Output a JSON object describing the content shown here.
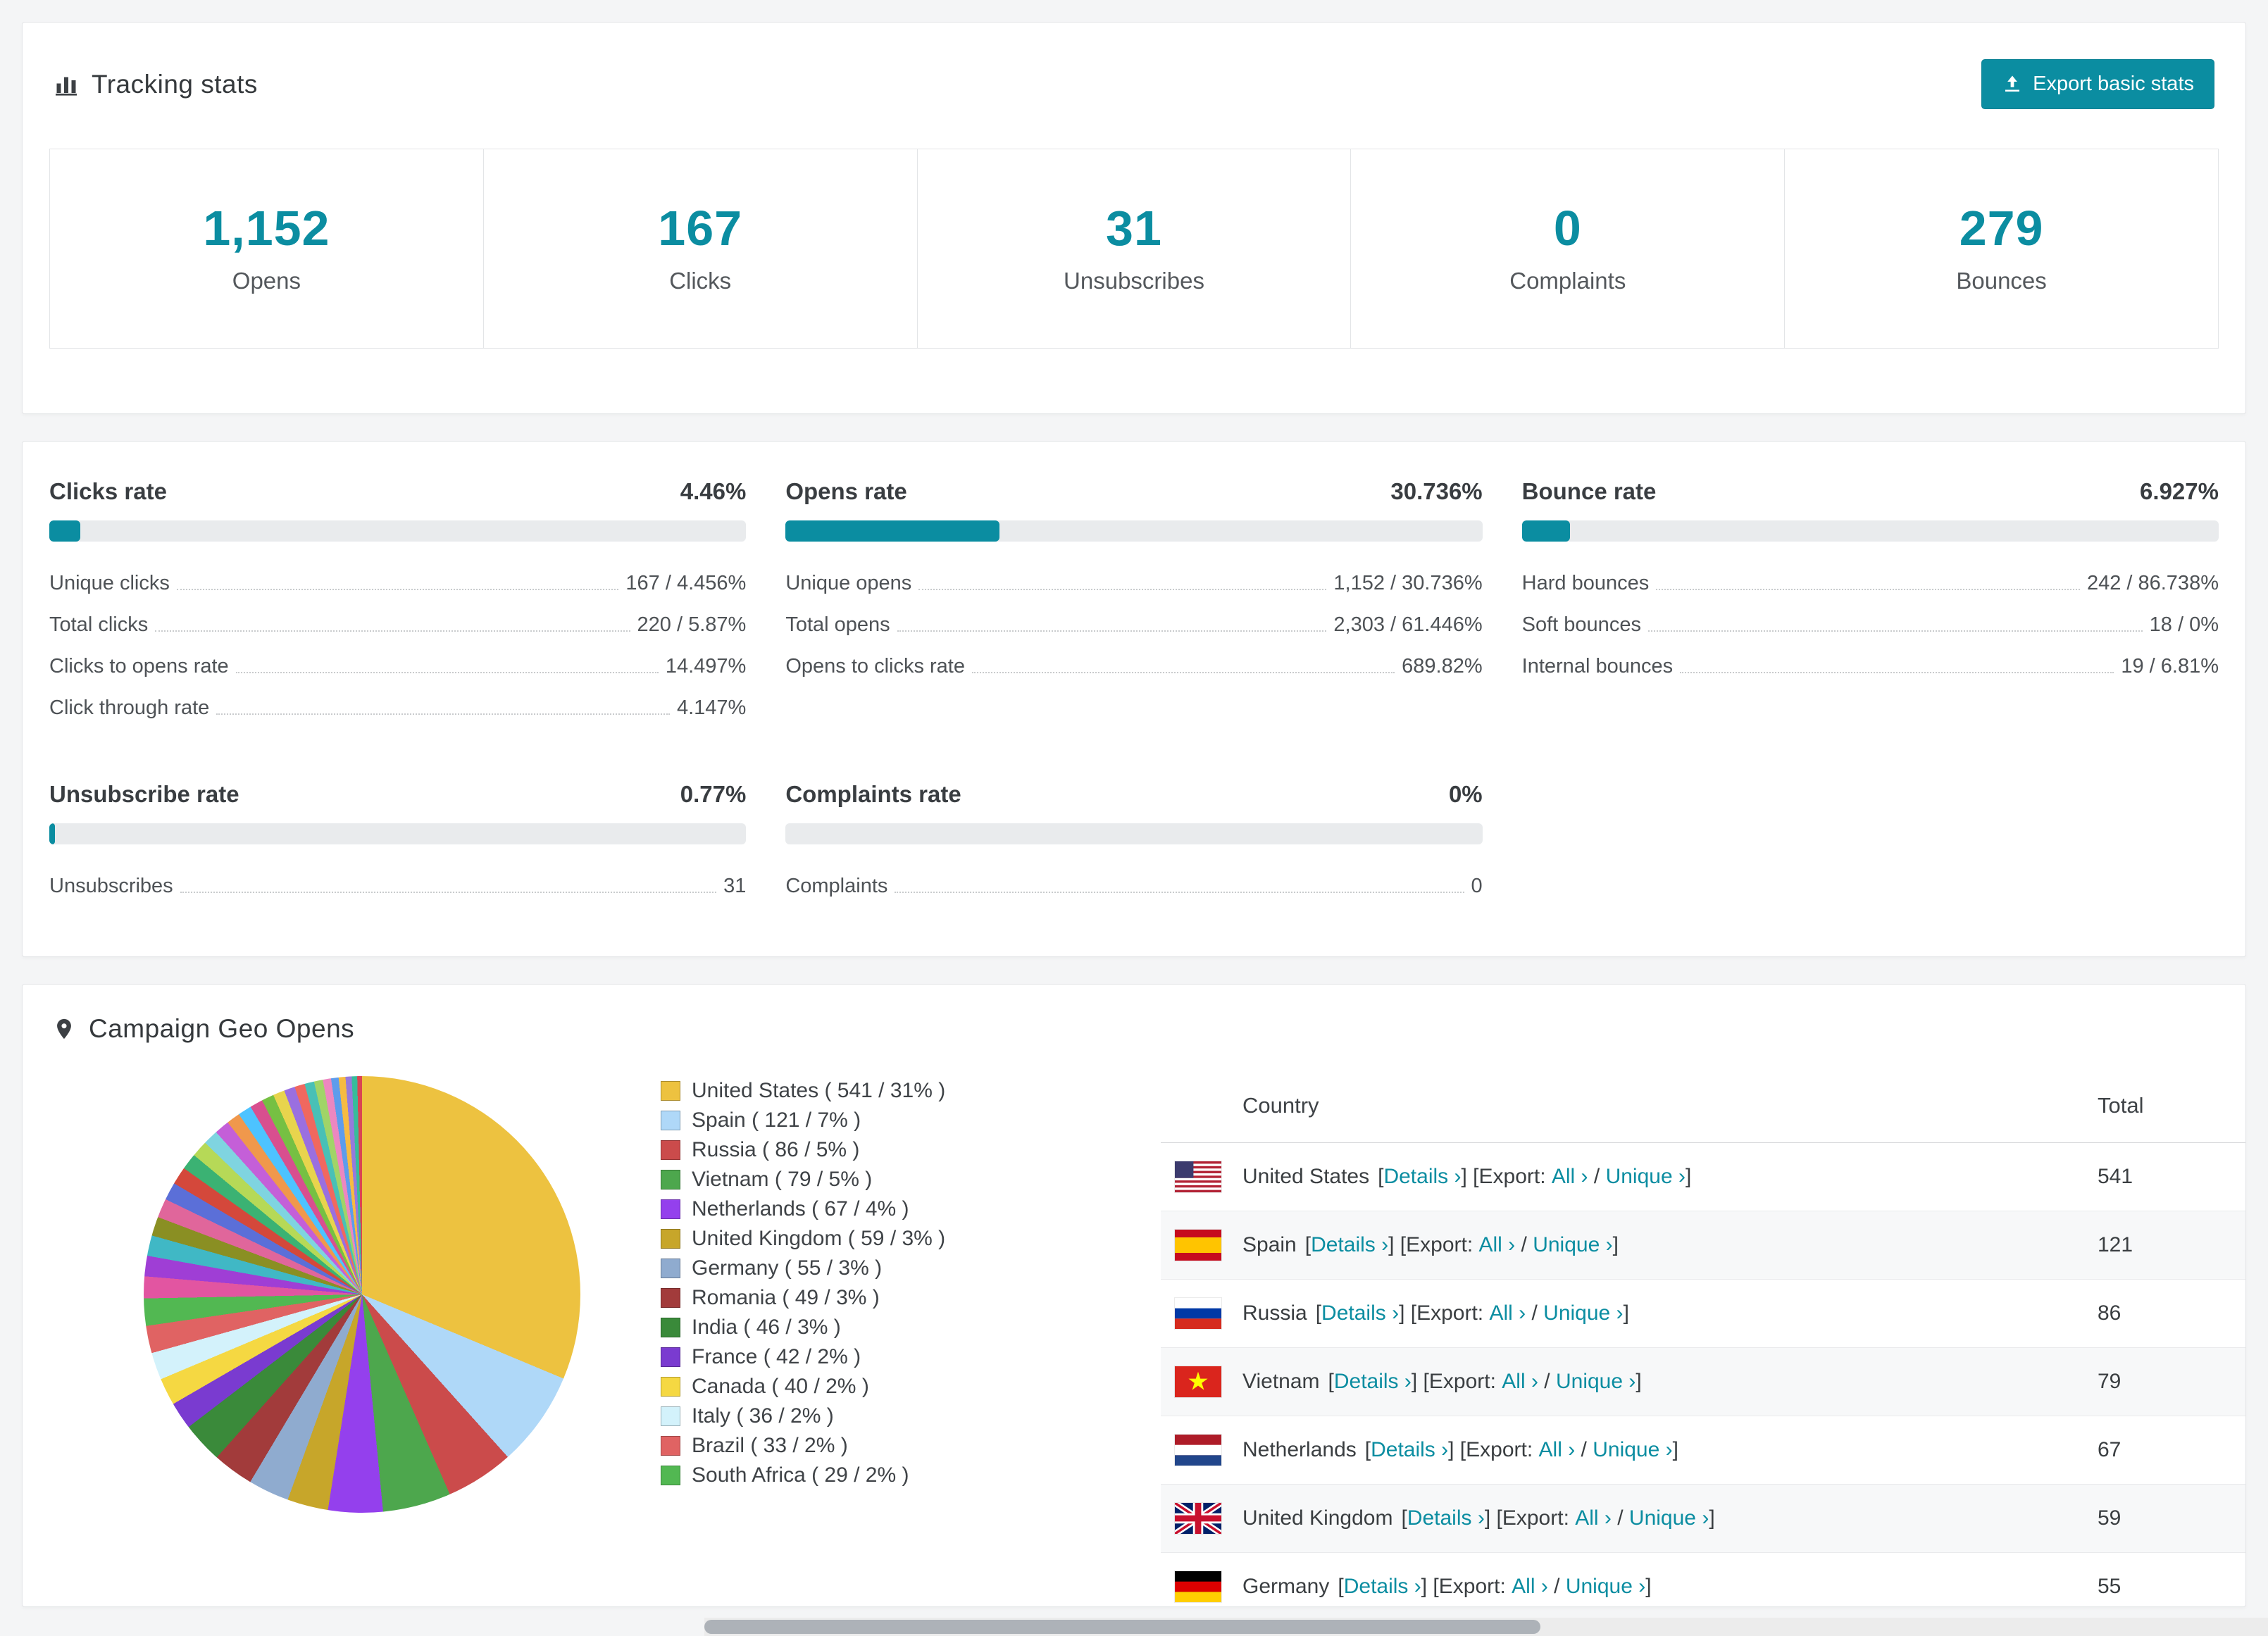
{
  "colors": {
    "accent": "#0b8da1",
    "page_bg": "#f4f5f6",
    "bar_track": "#e9ebed"
  },
  "tracking": {
    "title": "Tracking stats",
    "export_button": "Export basic stats",
    "icons": {
      "header": "bar-chart-icon",
      "export": "export-icon"
    },
    "stats": [
      {
        "value": "1,152",
        "label": "Opens"
      },
      {
        "value": "167",
        "label": "Clicks"
      },
      {
        "value": "31",
        "label": "Unsubscribes"
      },
      {
        "value": "0",
        "label": "Complaints"
      },
      {
        "value": "279",
        "label": "Bounces"
      }
    ]
  },
  "rates": [
    {
      "title": "Clicks rate",
      "value": "4.46%",
      "percent": 4.46,
      "rows": [
        {
          "label": "Unique clicks",
          "value": "167 / 4.456%"
        },
        {
          "label": "Total clicks",
          "value": "220 / 5.87%"
        },
        {
          "label": "Clicks to opens rate",
          "value": "14.497%"
        },
        {
          "label": "Click through rate",
          "value": "4.147%"
        }
      ]
    },
    {
      "title": "Opens rate",
      "value": "30.736%",
      "percent": 30.736,
      "rows": [
        {
          "label": "Unique opens",
          "value": "1,152 / 30.736%"
        },
        {
          "label": "Total opens",
          "value": "2,303 / 61.446%"
        },
        {
          "label": "Opens to clicks rate",
          "value": "689.82%"
        }
      ]
    },
    {
      "title": "Bounce rate",
      "value": "6.927%",
      "percent": 6.927,
      "rows": [
        {
          "label": "Hard bounces",
          "value": "242 / 86.738%"
        },
        {
          "label": "Soft bounces",
          "value": "18 / 0%"
        },
        {
          "label": "Internal bounces",
          "value": "19 / 6.81%"
        }
      ]
    },
    {
      "title": "Unsubscribe rate",
      "value": "0.77%",
      "percent": 0.77,
      "rows": [
        {
          "label": "Unsubscribes",
          "value": "31"
        }
      ]
    },
    {
      "title": "Complaints rate",
      "value": "0%",
      "percent": 0,
      "rows": [
        {
          "label": "Complaints",
          "value": "0"
        }
      ]
    }
  ],
  "geo": {
    "title": "Campaign Geo Opens",
    "icon": "map-pin-icon",
    "table": {
      "country_header": "Country",
      "total_header": "Total",
      "details_label": "Details ›",
      "export_label": "Export: ",
      "all_label": "All ›",
      "unique_label": "Unique ›",
      "rows": [
        {
          "country": "United States",
          "flag": "us",
          "total": "541"
        },
        {
          "country": "Spain",
          "flag": "es",
          "total": "121"
        },
        {
          "country": "Russia",
          "flag": "ru",
          "total": "86"
        },
        {
          "country": "Vietnam",
          "flag": "vn",
          "total": "79"
        },
        {
          "country": "Netherlands",
          "flag": "nl",
          "total": "67"
        },
        {
          "country": "United Kingdom",
          "flag": "gb",
          "total": "59"
        },
        {
          "country": "Germany",
          "flag": "de",
          "total": "55"
        }
      ]
    }
  },
  "chart_data": {
    "type": "pie",
    "title": "Campaign Geo Opens",
    "legend_position": "right",
    "slices": [
      {
        "label": "United States",
        "value": 541,
        "percent": 31,
        "color": "#edc240"
      },
      {
        "label": "Spain",
        "value": 121,
        "percent": 7,
        "color": "#afd8f8"
      },
      {
        "label": "Russia",
        "value": 86,
        "percent": 5,
        "color": "#cb4b4b"
      },
      {
        "label": "Vietnam",
        "value": 79,
        "percent": 5,
        "color": "#4da74d"
      },
      {
        "label": "Netherlands",
        "value": 67,
        "percent": 4,
        "color": "#9440ed"
      },
      {
        "label": "United Kingdom",
        "value": 59,
        "percent": 3,
        "color": "#c7a62a"
      },
      {
        "label": "Germany",
        "value": 55,
        "percent": 3,
        "color": "#8fabcf"
      },
      {
        "label": "Romania",
        "value": 49,
        "percent": 3,
        "color": "#a23b3b"
      },
      {
        "label": "India",
        "value": 46,
        "percent": 3,
        "color": "#3a8a3a"
      },
      {
        "label": "France",
        "value": 42,
        "percent": 2,
        "color": "#7a3bd0"
      },
      {
        "label": "Canada",
        "value": 40,
        "percent": 2,
        "color": "#f5d842"
      },
      {
        "label": "Italy",
        "value": 36,
        "percent": 2,
        "color": "#d3f2fb"
      },
      {
        "label": "Brazil",
        "value": 33,
        "percent": 2,
        "color": "#e06363"
      },
      {
        "label": "South Africa",
        "value": 29,
        "percent": 2,
        "color": "#52b852"
      }
    ],
    "other_slices": [
      {
        "percent": 1.6,
        "color": "#e255a1"
      },
      {
        "percent": 1.5,
        "color": "#9f3ed5"
      },
      {
        "percent": 1.5,
        "color": "#40b8c5"
      },
      {
        "percent": 1.4,
        "color": "#8a8f23"
      },
      {
        "percent": 1.4,
        "color": "#e0669b"
      },
      {
        "percent": 1.3,
        "color": "#5b6fd8"
      },
      {
        "percent": 1.3,
        "color": "#d4483b"
      },
      {
        "percent": 1.2,
        "color": "#3bb273"
      },
      {
        "percent": 1.2,
        "color": "#b6d957"
      },
      {
        "percent": 1.1,
        "color": "#7fd4e0"
      },
      {
        "percent": 1.1,
        "color": "#c45fd8"
      },
      {
        "percent": 1.0,
        "color": "#f0984c"
      },
      {
        "percent": 1.0,
        "color": "#4dc3ff"
      },
      {
        "percent": 0.95,
        "color": "#d84f8f"
      },
      {
        "percent": 0.9,
        "color": "#76c043"
      },
      {
        "percent": 0.85,
        "color": "#e8d44d"
      },
      {
        "percent": 0.8,
        "color": "#9a6fe0"
      },
      {
        "percent": 0.75,
        "color": "#f0685f"
      },
      {
        "percent": 0.7,
        "color": "#49c0b6"
      },
      {
        "percent": 0.65,
        "color": "#a0d468"
      },
      {
        "percent": 0.6,
        "color": "#ec87c0"
      },
      {
        "percent": 0.55,
        "color": "#5d9cec"
      },
      {
        "percent": 0.5,
        "color": "#f6bb42"
      },
      {
        "percent": 0.45,
        "color": "#967adc"
      },
      {
        "percent": 0.4,
        "color": "#37bc9b"
      },
      {
        "percent": 0.35,
        "color": "#da4453"
      }
    ]
  }
}
